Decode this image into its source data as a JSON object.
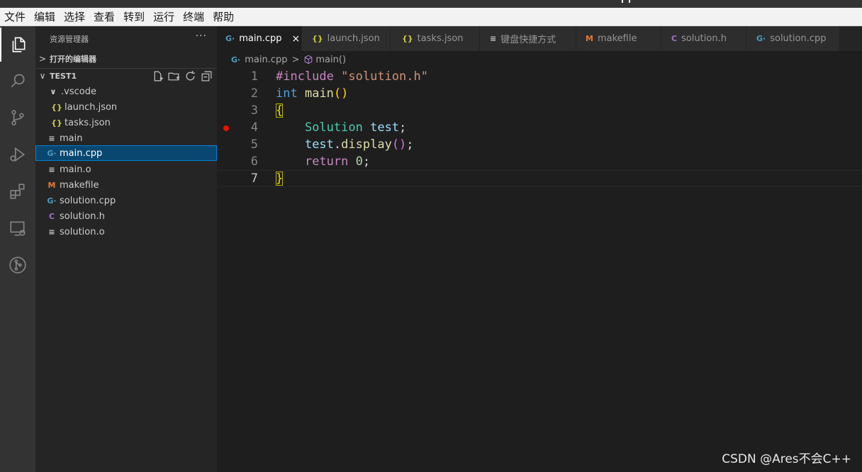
{
  "menubar": {
    "items": [
      "文件",
      "编辑",
      "选择",
      "查看",
      "转到",
      "运行",
      "终端",
      "帮助"
    ]
  },
  "activitybar": {
    "items": [
      "explorer-icon",
      "search-icon",
      "source-control-icon",
      "run-debug-icon",
      "extensions-icon",
      "remote-explorer-icon",
      "git-graph-icon"
    ]
  },
  "sidebar": {
    "title": "资源管理器",
    "more": "···",
    "open_editors": "打开的编辑器",
    "folder": "TEST1",
    "tree": [
      {
        "label": ".vscode",
        "icon": "chevron-down-icon",
        "glyph": "∨"
      },
      {
        "label": "launch.json",
        "icon": "json-file-icon",
        "glyph": "{}"
      },
      {
        "label": "tasks.json",
        "icon": "json-file-icon",
        "glyph": "{}"
      },
      {
        "label": "main",
        "icon": "text-file-icon",
        "glyph": "≡"
      },
      {
        "label": "main.cpp",
        "icon": "cpp-file-icon",
        "glyph": "G·"
      },
      {
        "label": "main.o",
        "icon": "text-file-icon",
        "glyph": "≡"
      },
      {
        "label": "makefile",
        "icon": "makefile-icon",
        "glyph": "M"
      },
      {
        "label": "solution.cpp",
        "icon": "cpp-file-icon",
        "glyph": "G·"
      },
      {
        "label": "solution.h",
        "icon": "header-file-icon",
        "glyph": "C"
      },
      {
        "label": "solution.o",
        "icon": "text-file-icon",
        "glyph": "≡"
      }
    ]
  },
  "tabs": [
    {
      "label": "main.cpp",
      "glyph": "G·",
      "close": "×"
    },
    {
      "label": "launch.json",
      "glyph": "{}"
    },
    {
      "label": "tasks.json",
      "glyph": "{}"
    },
    {
      "label": "键盘快捷方式",
      "glyph": "≡"
    },
    {
      "label": "makefile",
      "glyph": "M"
    },
    {
      "label": "solution.h",
      "glyph": "C"
    },
    {
      "label": "solution.cpp",
      "glyph": "G·"
    }
  ],
  "breadcrumb": {
    "file": "main.cpp",
    "file_glyph": "G·",
    "sep": ">",
    "symbol": "main()"
  },
  "editor": {
    "line_numbers": [
      "1",
      "2",
      "3",
      "4",
      "5",
      "6",
      "7"
    ],
    "code": {
      "l1_pp": "#include",
      "l1_str": "\"solution.h\"",
      "l2_kw": "int",
      "l2_fn": "main",
      "l2_paren": "()",
      "l3_brace": "{",
      "l4_indent": "    ",
      "l4_type": "Solution",
      "l4_var": "test",
      "l4_semi": ";",
      "l5_var": "test",
      "l5_dot": ".",
      "l5_fn": "display",
      "l5_paren": "()",
      "l5_semi": ";",
      "l6_kw": "return",
      "l6_num": "0",
      "l6_semi": ";",
      "l7_brace": "}"
    },
    "breakpoint_line": "4",
    "current_line": "7"
  },
  "watermark": "CSDN @Ares不会C++"
}
